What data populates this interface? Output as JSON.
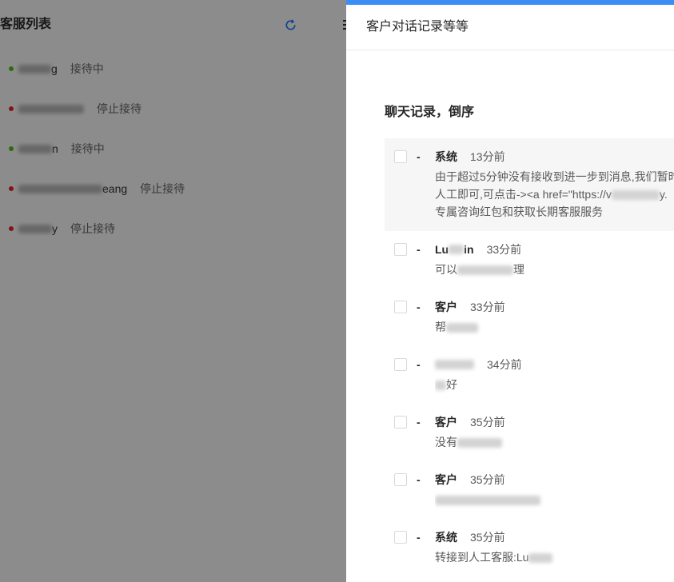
{
  "colors": {
    "accent": "#1677ff",
    "online": "#52c41a",
    "offline": "#f5222d",
    "drawer_bar": "#3b8ef5",
    "mask": "rgba(0,0,0,0.45)"
  },
  "list_page": {
    "title": "客服列表",
    "refresh_icon": "refresh-icon",
    "menu_icon": "menu-icon",
    "agents": [
      {
        "name_visible": "g",
        "status": "接待中",
        "online": true
      },
      {
        "status": "停止接待",
        "online": false
      },
      {
        "name_visible": "n",
        "status": "接待中",
        "online": true
      },
      {
        "name_visible": "eang",
        "status": "停止接待",
        "online": false
      },
      {
        "name_visible": "y",
        "status": "停止接待",
        "online": false
      }
    ]
  },
  "drawer": {
    "title": "客户对话记录等等",
    "heading": "聊天记录，倒序",
    "separator": "-",
    "records": [
      {
        "sender": "系统",
        "time": "13分前",
        "highlighted": true,
        "checked": false,
        "lines": [
          {
            "text": "由于超过5分钟没有接收到进一步到消息,我们暂时"
          },
          {
            "text": "人工即可,可点击-><a href=\"https://v",
            "after": "y."
          },
          {
            "text": "专属咨询红包和获取长期客服服务"
          }
        ]
      },
      {
        "sender": "Lu",
        "sender_after": "in",
        "time": "33分前",
        "checked": false,
        "message": "可以",
        "message_after": "理"
      },
      {
        "sender": "客户",
        "time": "33分前",
        "checked": false,
        "message": "帮"
      },
      {
        "time": "34分前",
        "checked": false,
        "message_after": "好"
      },
      {
        "sender": "客户",
        "time": "35分前",
        "checked": false,
        "message": "没有"
      },
      {
        "sender": "客户",
        "time": "35分前",
        "checked": false
      },
      {
        "sender": "系统",
        "time": "35分前",
        "checked": false,
        "message": "转接到人工客服:Lu"
      }
    ]
  }
}
